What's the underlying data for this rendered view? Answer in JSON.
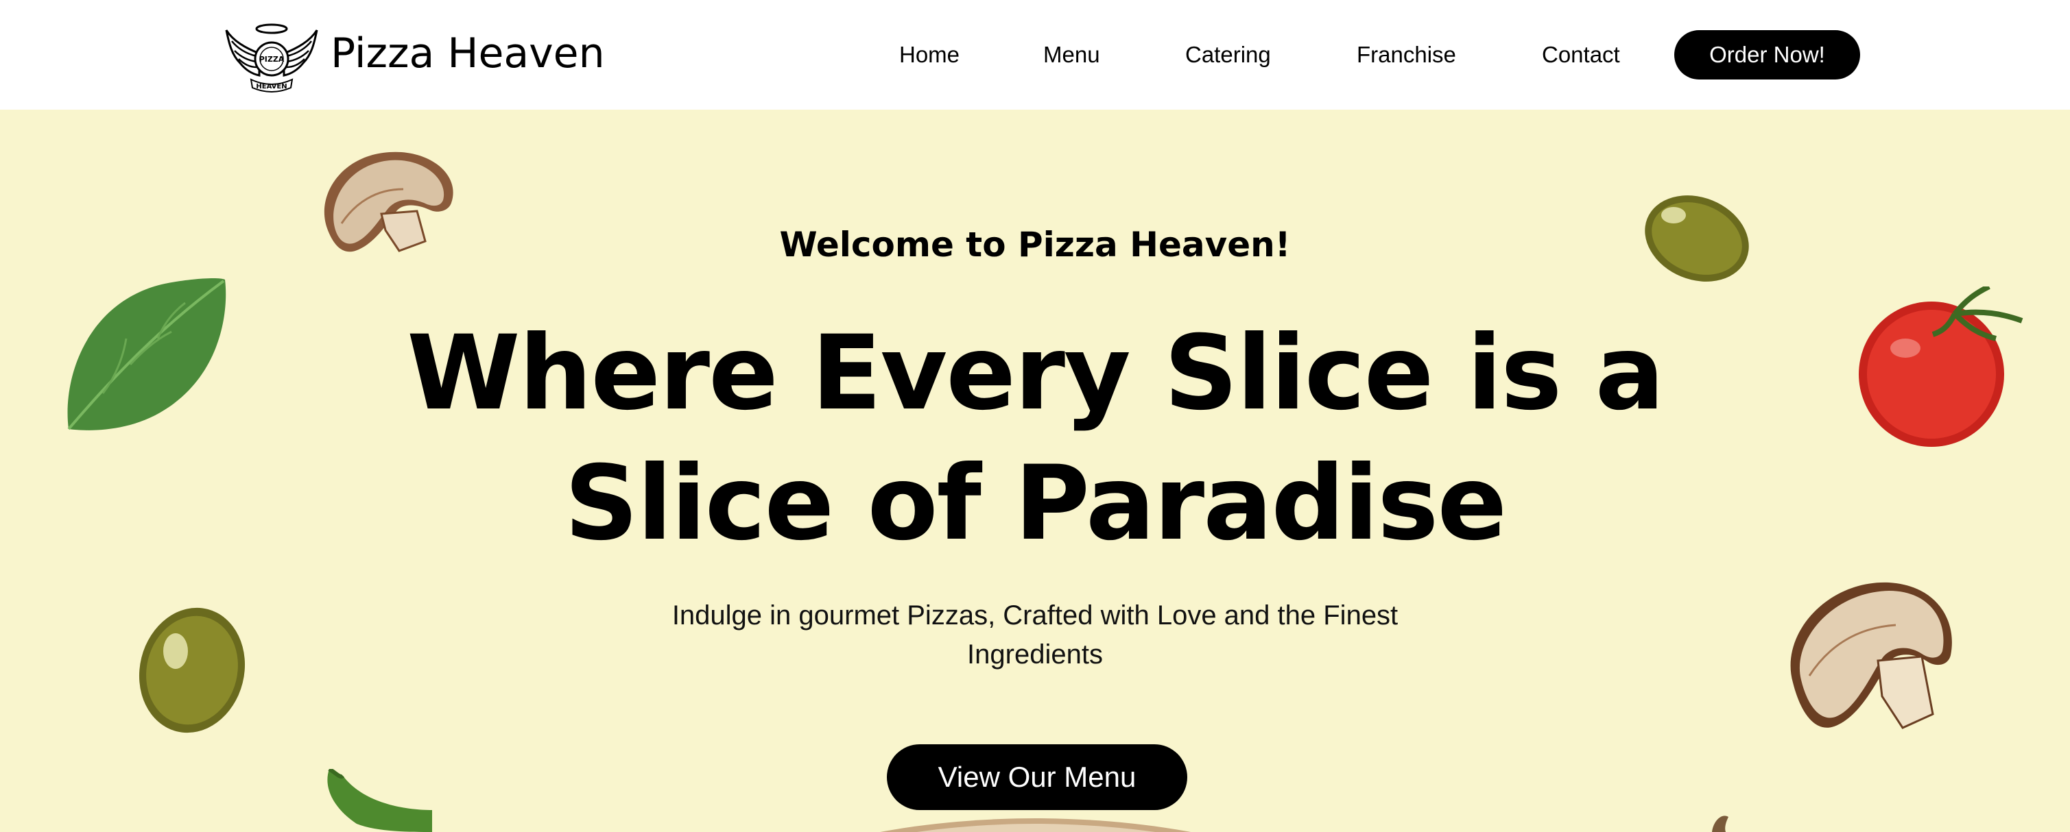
{
  "header": {
    "brand": "Pizza Heaven",
    "logo_icon": "winged-pizza-logo",
    "logo_text_top": "PIZZA",
    "logo_text_bottom": "HEAVEN",
    "nav": [
      {
        "label": "Home"
      },
      {
        "label": "Menu"
      },
      {
        "label": "Catering"
      },
      {
        "label": "Franchise"
      },
      {
        "label": "Contact"
      }
    ],
    "cta_label": "Order Now!"
  },
  "hero": {
    "welcome": "Welcome to Pizza Heaven!",
    "headline_line1": "Where Every Slice is a",
    "headline_line2": "Slice of Paradise",
    "subtitle": "Indulge in gourmet Pizzas, Crafted with Love and the Finest Ingredients",
    "cta_label": "View Our Menu",
    "ingredients": [
      "basil-leaf",
      "mushroom",
      "olive",
      "tomato",
      "jalapeno",
      "pizza"
    ]
  },
  "colors": {
    "header_bg": "#ffffff",
    "hero_bg": "#f9f5cd",
    "button_bg": "#000000",
    "button_text": "#ffffff",
    "text": "#000000"
  }
}
